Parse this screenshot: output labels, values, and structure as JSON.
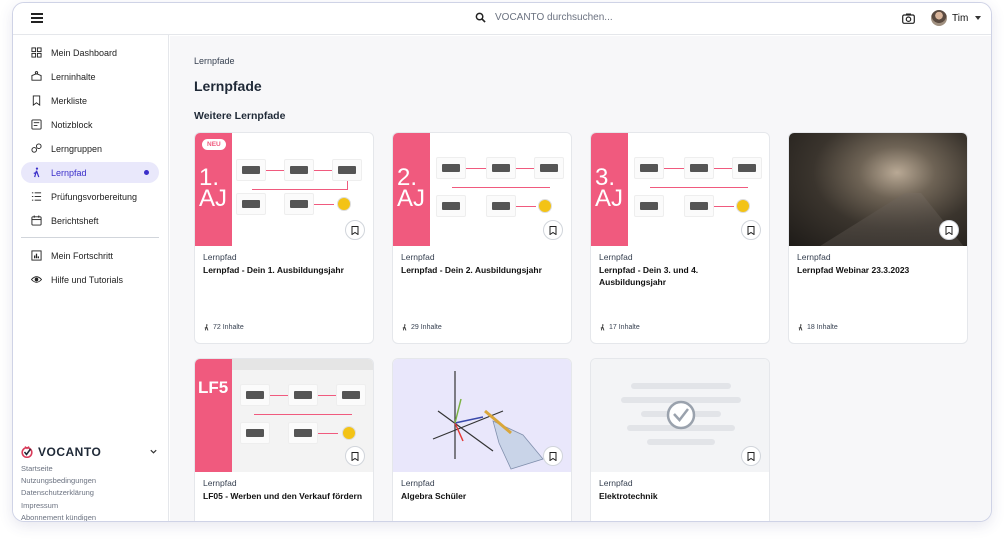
{
  "topbar": {
    "search_placeholder": "VOCANTO durchsuchen...",
    "user_name": "Tim"
  },
  "sidebar": {
    "items": [
      {
        "label": "Mein Dashboard",
        "icon": "dashboard-icon"
      },
      {
        "label": "Lerninhalte",
        "icon": "content-icon"
      },
      {
        "label": "Merkliste",
        "icon": "bookmark-icon"
      },
      {
        "label": "Notizblock",
        "icon": "note-icon"
      },
      {
        "label": "Lerngruppen",
        "icon": "group-icon"
      },
      {
        "label": "Lernpfad",
        "icon": "path-icon",
        "active": true
      },
      {
        "label": "Prüfungsvorbereitung",
        "icon": "list-icon"
      },
      {
        "label": "Berichtsheft",
        "icon": "calendar-icon"
      },
      {
        "label": "Mein Fortschritt",
        "icon": "chart-icon"
      },
      {
        "label": "Hilfe und Tutorials",
        "icon": "eye-icon"
      }
    ],
    "brand": "VOCANTO",
    "footer_links": [
      "Startseite",
      "Nutzungsbedingungen",
      "Datenschutzerklärung",
      "Impressum",
      "Abonnement kündigen"
    ]
  },
  "main": {
    "breadcrumb": "Lernpfade",
    "title": "Lernpfade",
    "section_title": "Weitere Lernpfade",
    "cards": [
      {
        "type": "Lernpfad",
        "title": "Lernpfad - Dein 1. Ausbildungsjahr",
        "count": "72 Inhalte",
        "badge": "NEU",
        "thumb_label": "1. AJ"
      },
      {
        "type": "Lernpfad",
        "title": "Lernpfad - Dein 2. Ausbildungsjahr",
        "count": "29 Inhalte",
        "thumb_label": "2. AJ"
      },
      {
        "type": "Lernpfad",
        "title": "Lernpfad - Dein 3. und 4. Ausbildungsjahr",
        "count": "17 Inhalte",
        "thumb_label": "3. AJ"
      },
      {
        "type": "Lernpfad",
        "title": "Lernpfad Webinar 23.3.2023",
        "count": "18 Inhalte"
      },
      {
        "type": "Lernpfad",
        "title": "LF05 - Werben und den Verkauf fördern",
        "thumb_label": "LF5"
      },
      {
        "type": "Lernpfad",
        "title": "Algebra Schüler"
      },
      {
        "type": "Lernpfad",
        "title": "Elektrotechnik"
      }
    ]
  },
  "colors": {
    "accent": "#3b2fc9",
    "brand_pink": "#f05a7e",
    "active_bg": "#e9e8fb"
  }
}
